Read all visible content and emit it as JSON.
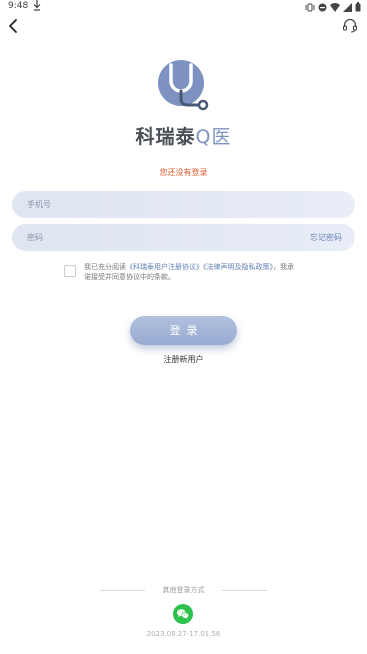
{
  "status_bar": {
    "time": "9:48"
  },
  "brand": {
    "name_part1": "科瑞泰",
    "name_q": "Q",
    "name_part2": "医"
  },
  "login_hint": "您还没有登录",
  "phone_input": {
    "placeholder": "手机号",
    "value": ""
  },
  "password_input": {
    "placeholder": "密码",
    "value": ""
  },
  "forgot_password": "忘记密码",
  "agreement": {
    "checked": false,
    "text_before": "我已充分阅读",
    "user_agreement": "《科瑞泰用户注册协议》",
    "privacy_policy": "《法律声明及隐私政策》",
    "text_after": "，我承诺接受并同意协议中的条款。"
  },
  "login_button": "登录",
  "register_link": "注册新用户",
  "other_login_label": "其他登录方式",
  "build_version": "2023.08.27-17.01.56",
  "colors": {
    "accent": "#97abd2",
    "hint": "#e05a2a",
    "link": "#5f7fb4",
    "wechat": "#2dc24b"
  },
  "icons": {
    "back": "chevron-left-icon",
    "support": "headset-icon",
    "wechat": "wechat-icon"
  }
}
